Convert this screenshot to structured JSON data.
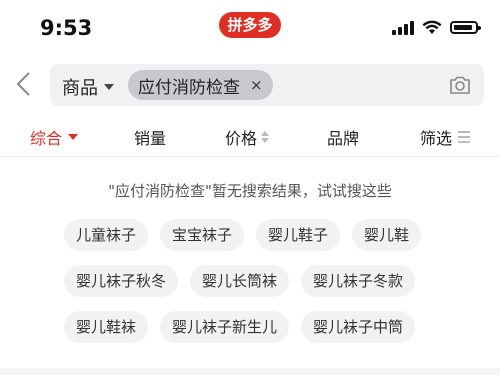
{
  "status_bar": {
    "time": "9:53",
    "app_name": "拼多多"
  },
  "search": {
    "scope_label": "商品",
    "query": "应付消防检查",
    "clear_symbol": "×"
  },
  "filters": {
    "tabs": [
      {
        "label": "综合",
        "active": true
      },
      {
        "label": "销量",
        "active": false
      },
      {
        "label": "价格",
        "active": false
      },
      {
        "label": "品牌",
        "active": false
      },
      {
        "label": "筛选",
        "active": false
      }
    ]
  },
  "results": {
    "no_result_text": "\"应付消防检查\"暂无搜索结果，试试搜这些"
  },
  "suggestions": {
    "rows": [
      [
        "儿童袜子",
        "宝宝袜子",
        "婴儿鞋子",
        "婴儿鞋"
      ],
      [
        "婴儿袜子秋冬",
        "婴儿长筒袜",
        "婴儿袜子冬款"
      ],
      [
        "婴儿鞋袜",
        "婴儿袜子新生儿",
        "婴儿袜子中筒"
      ]
    ]
  },
  "colors": {
    "accent": "#e02e24",
    "chip_bg": "#f2f2f4"
  }
}
